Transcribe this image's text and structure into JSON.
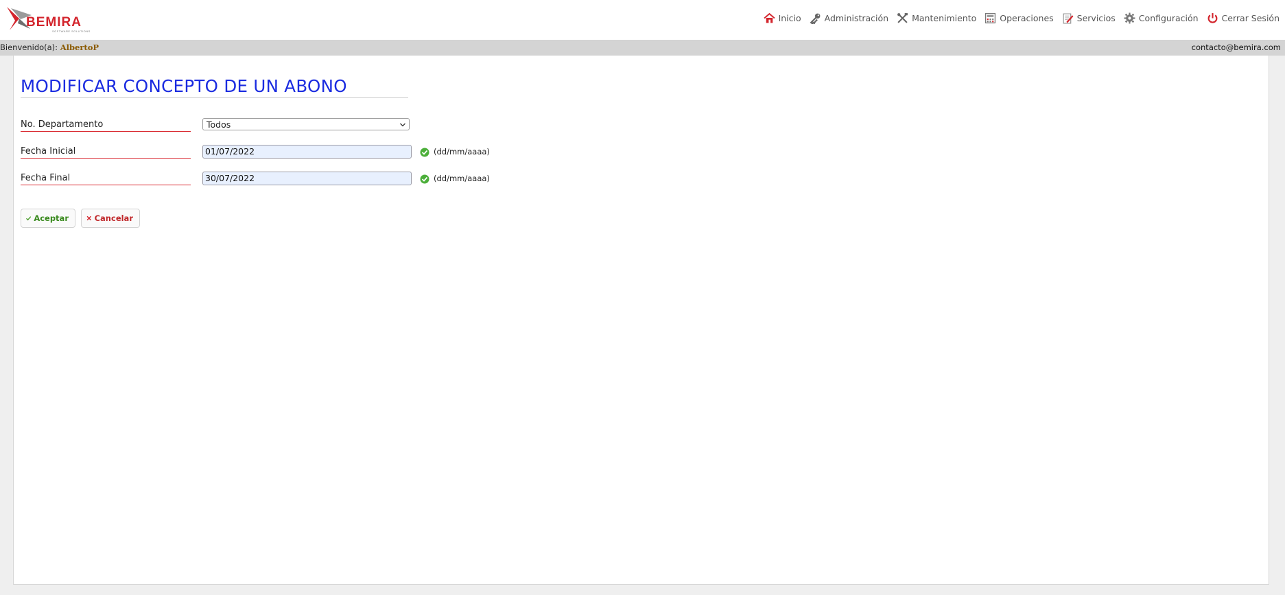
{
  "logo": {
    "text": "BEMIRA",
    "tagline": "SOFTWARE SOLUTIONS",
    "brand_color": "#d3242c"
  },
  "nav": {
    "items": [
      {
        "label": "Inicio",
        "icon": "home-icon"
      },
      {
        "label": "Administración",
        "icon": "key-icon"
      },
      {
        "label": "Mantenimiento",
        "icon": "tools-icon"
      },
      {
        "label": "Operaciones",
        "icon": "calculator-icon"
      },
      {
        "label": "Servicios",
        "icon": "edit-document-icon"
      },
      {
        "label": "Configuración",
        "icon": "gear-icon"
      },
      {
        "label": "Cerrar Sesión",
        "icon": "power-icon"
      }
    ]
  },
  "welcome": {
    "prefix": "Bienvenido(a):",
    "user": "AlbertoP",
    "contact": "contacto@bemira.com"
  },
  "page": {
    "title": "MODIFICAR CONCEPTO DE UN ABONO",
    "title_color": "#1a2be0"
  },
  "form": {
    "departamento": {
      "label": "No. Departamento",
      "value": "Todos"
    },
    "fecha_inicial": {
      "label": "Fecha Inicial",
      "value": "01/07/2022",
      "format": "(dd/mm/aaaa)"
    },
    "fecha_final": {
      "label": "Fecha Final",
      "value": "30/07/2022",
      "format": "(dd/mm/aaaa)"
    }
  },
  "buttons": {
    "accept": "Aceptar",
    "cancel": "Cancelar"
  }
}
